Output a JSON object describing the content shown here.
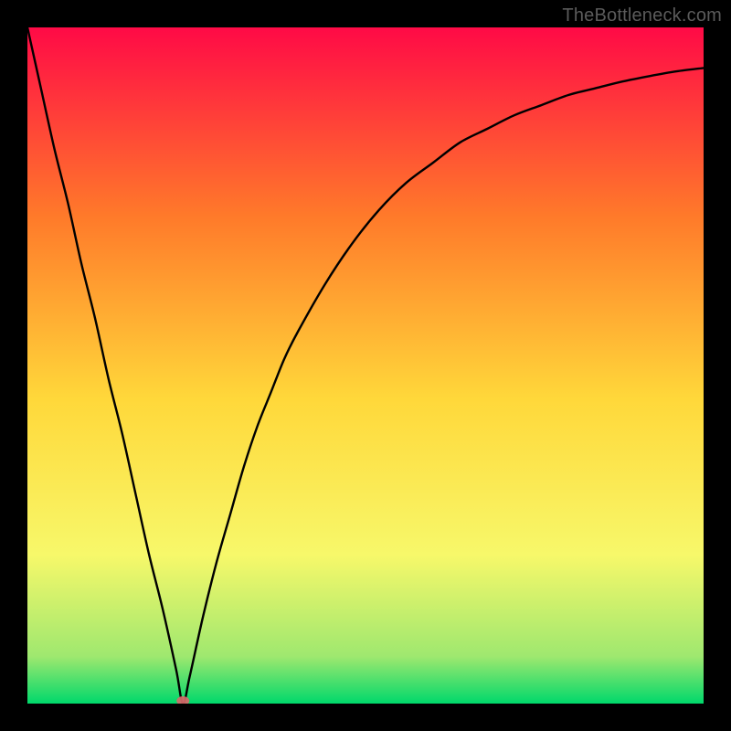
{
  "watermark": "TheBottleneck.com",
  "chart_data": {
    "type": "line",
    "title": "",
    "xlabel": "",
    "ylabel": "",
    "xlim": [
      0,
      100
    ],
    "ylim": [
      0,
      100
    ],
    "grid": false,
    "legend": false,
    "minimum_marker": {
      "x": 23,
      "y": 0,
      "color": "#d66a6a"
    },
    "series": [
      {
        "name": "curve",
        "color": "#000000",
        "x": [
          0,
          2,
          4,
          6,
          8,
          10,
          12,
          14,
          16,
          18,
          20,
          22,
          23,
          24,
          26,
          28,
          30,
          32,
          34,
          36,
          38,
          40,
          44,
          48,
          52,
          56,
          60,
          64,
          68,
          72,
          76,
          80,
          84,
          88,
          92,
          96,
          100
        ],
        "y": [
          100,
          91,
          82,
          74,
          65,
          57,
          48,
          40,
          31,
          22,
          14,
          5,
          0,
          4,
          13,
          21,
          28,
          35,
          41,
          46,
          51,
          55,
          62,
          68,
          73,
          77,
          80,
          83,
          85,
          87,
          88.5,
          90,
          91,
          92,
          92.8,
          93.5,
          94
        ]
      }
    ],
    "background_gradient": {
      "top": "#ff0a46",
      "upper_mid": "#ff7a2a",
      "mid": "#ffd83a",
      "lower_mid": "#f7f86a",
      "near_bottom": "#9fe86f",
      "bottom": "#00d86b"
    }
  }
}
